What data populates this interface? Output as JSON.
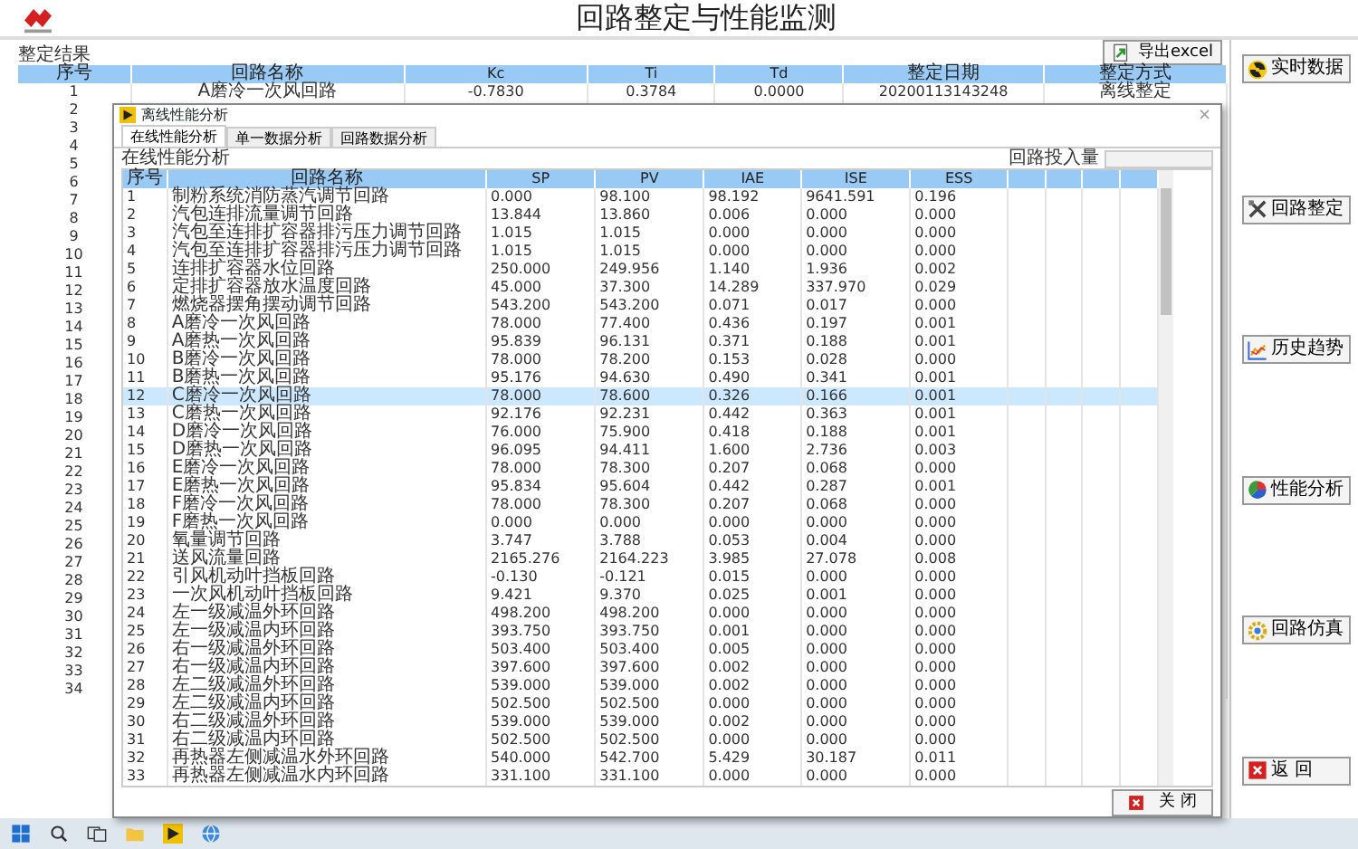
{
  "header": {
    "title": "回路整定与性能监测"
  },
  "results": {
    "label": "整定结果",
    "export_button": "导出excel",
    "columns": [
      "序号",
      "回路名称",
      "Kc",
      "Ti",
      "Td",
      "整定日期",
      "整定方式"
    ],
    "rows": [
      {
        "cells": [
          "1",
          "A磨冷一次风回路",
          "-0.7830",
          "0.3784",
          "0.0000",
          "20200113143248",
          "离线整定"
        ]
      },
      {
        "cells": [
          "2"
        ]
      },
      {
        "cells": [
          "3"
        ]
      },
      {
        "cells": [
          "4"
        ]
      },
      {
        "cells": [
          "5"
        ]
      },
      {
        "cells": [
          "6"
        ]
      },
      {
        "cells": [
          "7"
        ]
      },
      {
        "cells": [
          "8"
        ]
      },
      {
        "cells": [
          "9"
        ]
      },
      {
        "cells": [
          "10"
        ]
      },
      {
        "cells": [
          "11"
        ]
      },
      {
        "cells": [
          "12"
        ]
      },
      {
        "cells": [
          "13"
        ]
      },
      {
        "cells": [
          "14"
        ]
      },
      {
        "cells": [
          "15"
        ]
      },
      {
        "cells": [
          "16"
        ]
      },
      {
        "cells": [
          "17"
        ]
      },
      {
        "cells": [
          "18"
        ]
      },
      {
        "cells": [
          "19"
        ]
      },
      {
        "cells": [
          "20"
        ]
      },
      {
        "cells": [
          "21"
        ]
      },
      {
        "cells": [
          "22"
        ]
      },
      {
        "cells": [
          "23"
        ]
      },
      {
        "cells": [
          "24"
        ]
      },
      {
        "cells": [
          "25"
        ]
      },
      {
        "cells": [
          "26"
        ]
      },
      {
        "cells": [
          "27"
        ]
      },
      {
        "cells": [
          "28"
        ]
      },
      {
        "cells": [
          "29"
        ]
      },
      {
        "cells": [
          "30"
        ]
      },
      {
        "cells": [
          "31"
        ]
      },
      {
        "cells": [
          "32"
        ]
      },
      {
        "cells": [
          "33"
        ]
      },
      {
        "cells": [
          "34"
        ]
      }
    ]
  },
  "dialog": {
    "title": "离线性能分析",
    "close_glyph": "×",
    "tabs": [
      {
        "label": "在线性能分析",
        "selected": true
      },
      {
        "label": "单一数据分析",
        "selected": false
      },
      {
        "label": "回路数据分析",
        "selected": false
      }
    ],
    "section_label": "在线性能分析",
    "input_label": "回路投入量",
    "columns": [
      "序号",
      "回路名称",
      "SP",
      "PV",
      "IAE",
      "ISE",
      "ESS"
    ],
    "rows": [
      {
        "cells": [
          "1",
          "制粉系统消防蒸汽调节回路",
          "0.000",
          "98.100",
          "98.192",
          "9641.591",
          "0.196"
        ],
        "selected": false
      },
      {
        "cells": [
          "2",
          "汽包连排流量调节回路",
          "13.844",
          "13.860",
          "0.006",
          "0.000",
          "0.000"
        ],
        "selected": false
      },
      {
        "cells": [
          "3",
          "汽包至连排扩容器排污压力调节回路",
          "1.015",
          "1.015",
          "0.000",
          "0.000",
          "0.000"
        ],
        "selected": false
      },
      {
        "cells": [
          "4",
          "汽包至连排扩容器排污压力调节回路",
          "1.015",
          "1.015",
          "0.000",
          "0.000",
          "0.000"
        ],
        "selected": false
      },
      {
        "cells": [
          "5",
          "连排扩容器水位回路",
          "250.000",
          "249.956",
          "1.140",
          "1.936",
          "0.002"
        ],
        "selected": false
      },
      {
        "cells": [
          "6",
          "定排扩容器放水温度回路",
          "45.000",
          "37.300",
          "14.289",
          "337.970",
          "0.029"
        ],
        "selected": false
      },
      {
        "cells": [
          "7",
          "燃烧器摆角摆动调节回路",
          "543.200",
          "543.200",
          "0.071",
          "0.017",
          "0.000"
        ],
        "selected": false
      },
      {
        "cells": [
          "8",
          "A磨冷一次风回路",
          "78.000",
          "77.400",
          "0.436",
          "0.197",
          "0.001"
        ],
        "selected": false
      },
      {
        "cells": [
          "9",
          "A磨热一次风回路",
          "95.839",
          "96.131",
          "0.371",
          "0.188",
          "0.001"
        ],
        "selected": false
      },
      {
        "cells": [
          "10",
          "B磨冷一次风回路",
          "78.000",
          "78.200",
          "0.153",
          "0.028",
          "0.000"
        ],
        "selected": false
      },
      {
        "cells": [
          "11",
          "B磨热一次风回路",
          "95.176",
          "94.630",
          "0.490",
          "0.341",
          "0.001"
        ],
        "selected": false
      },
      {
        "cells": [
          "12",
          "C磨冷一次风回路",
          "78.000",
          "78.600",
          "0.326",
          "0.166",
          "0.001"
        ],
        "selected": true
      },
      {
        "cells": [
          "13",
          "C磨热一次风回路",
          "92.176",
          "92.231",
          "0.442",
          "0.363",
          "0.001"
        ],
        "selected": false
      },
      {
        "cells": [
          "14",
          "D磨冷一次风回路",
          "76.000",
          "75.900",
          "0.418",
          "0.188",
          "0.001"
        ],
        "selected": false
      },
      {
        "cells": [
          "15",
          "D磨热一次风回路",
          "96.095",
          "94.411",
          "1.600",
          "2.736",
          "0.003"
        ],
        "selected": false
      },
      {
        "cells": [
          "16",
          "E磨冷一次风回路",
          "78.000",
          "78.300",
          "0.207",
          "0.068",
          "0.000"
        ],
        "selected": false
      },
      {
        "cells": [
          "17",
          "E磨热一次风回路",
          "95.834",
          "95.604",
          "0.442",
          "0.287",
          "0.001"
        ],
        "selected": false
      },
      {
        "cells": [
          "18",
          "F磨冷一次风回路",
          "78.000",
          "78.300",
          "0.207",
          "0.068",
          "0.000"
        ],
        "selected": false
      },
      {
        "cells": [
          "19",
          "F磨热一次风回路",
          "0.000",
          "0.000",
          "0.000",
          "0.000",
          "0.000"
        ],
        "selected": false
      },
      {
        "cells": [
          "20",
          "氧量调节回路",
          "3.747",
          "3.788",
          "0.053",
          "0.004",
          "0.000"
        ],
        "selected": false
      },
      {
        "cells": [
          "21",
          "送风流量回路",
          "2165.276",
          "2164.223",
          "3.985",
          "27.078",
          "0.008"
        ],
        "selected": false
      },
      {
        "cells": [
          "22",
          "引风机动叶挡板回路",
          "-0.130",
          "-0.121",
          "0.015",
          "0.000",
          "0.000"
        ],
        "selected": false
      },
      {
        "cells": [
          "23",
          "一次风机动叶挡板回路",
          "9.421",
          "9.370",
          "0.025",
          "0.001",
          "0.000"
        ],
        "selected": false
      },
      {
        "cells": [
          "24",
          "左一级减温外环回路",
          "498.200",
          "498.200",
          "0.000",
          "0.000",
          "0.000"
        ],
        "selected": false
      },
      {
        "cells": [
          "25",
          "左一级减温内环回路",
          "393.750",
          "393.750",
          "0.001",
          "0.000",
          "0.000"
        ],
        "selected": false
      },
      {
        "cells": [
          "26",
          "右一级减温外环回路",
          "503.400",
          "503.400",
          "0.005",
          "0.000",
          "0.000"
        ],
        "selected": false
      },
      {
        "cells": [
          "27",
          "右一级减温内环回路",
          "397.600",
          "397.600",
          "0.002",
          "0.000",
          "0.000"
        ],
        "selected": false
      },
      {
        "cells": [
          "28",
          "左二级减温外环回路",
          "539.000",
          "539.000",
          "0.002",
          "0.000",
          "0.000"
        ],
        "selected": false
      },
      {
        "cells": [
          "29",
          "左二级减温内环回路",
          "502.500",
          "502.500",
          "0.000",
          "0.000",
          "0.000"
        ],
        "selected": false
      },
      {
        "cells": [
          "30",
          "右二级减温外环回路",
          "539.000",
          "539.000",
          "0.002",
          "0.000",
          "0.000"
        ],
        "selected": false
      },
      {
        "cells": [
          "31",
          "右二级减温内环回路",
          "502.500",
          "502.500",
          "0.000",
          "0.000",
          "0.000"
        ],
        "selected": false
      },
      {
        "cells": [
          "32",
          "再热器左侧减温水外环回路",
          "540.000",
          "542.700",
          "5.429",
          "30.187",
          "0.011"
        ],
        "selected": false
      },
      {
        "cells": [
          "33",
          "再热器左侧减温水内环回路",
          "331.100",
          "331.100",
          "0.000",
          "0.000",
          "0.000"
        ],
        "selected": false
      }
    ],
    "close_button": "关 闭"
  },
  "sidebar": {
    "buttons": [
      {
        "label": "实时数据",
        "kind": "radiation"
      },
      {
        "label": "回路整定",
        "kind": "tools"
      },
      {
        "label": "历史趋势",
        "kind": "trend"
      },
      {
        "label": "性能分析",
        "kind": "pie"
      },
      {
        "label": "回路仿真",
        "kind": "gear"
      },
      {
        "label": "返 回",
        "kind": "exit"
      }
    ]
  }
}
